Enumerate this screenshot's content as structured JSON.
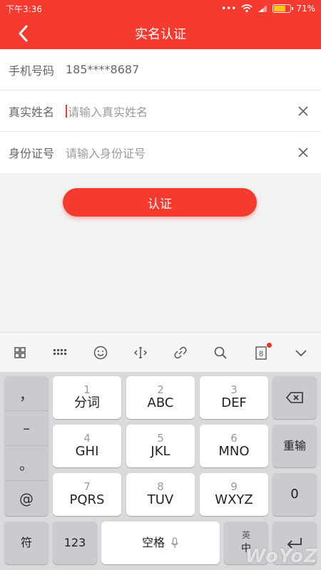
{
  "status": {
    "time": "下午3:36",
    "dots": "•••",
    "battery": "71%"
  },
  "nav": {
    "title": "实名认证"
  },
  "form": {
    "phone_label": "手机号码",
    "phone_value": "185****8687",
    "name_label": "真实姓名",
    "name_placeholder": "请输入真实姓名",
    "id_label": "身份证号",
    "id_placeholder": "请输入身份证号"
  },
  "submit_label": "认证",
  "keyboard": {
    "side_keys": [
      "，",
      "–",
      "。",
      "@"
    ],
    "keys": [
      {
        "num": "1",
        "main": "分词"
      },
      {
        "num": "2",
        "main": "ABC"
      },
      {
        "num": "3",
        "main": "DEF"
      },
      {
        "num": "4",
        "main": "GHI"
      },
      {
        "num": "5",
        "main": "JKL"
      },
      {
        "num": "6",
        "main": "MNO"
      },
      {
        "num": "7",
        "main": "PQRS"
      },
      {
        "num": "8",
        "main": "TUV"
      },
      {
        "num": "9",
        "main": "WXYZ"
      }
    ],
    "reinput": "重输",
    "zero": "0",
    "symbol": "符",
    "num123": "123",
    "space": "空格",
    "lang_top": "英",
    "lang_bottom": "中"
  },
  "watermark": "WoYoZ"
}
